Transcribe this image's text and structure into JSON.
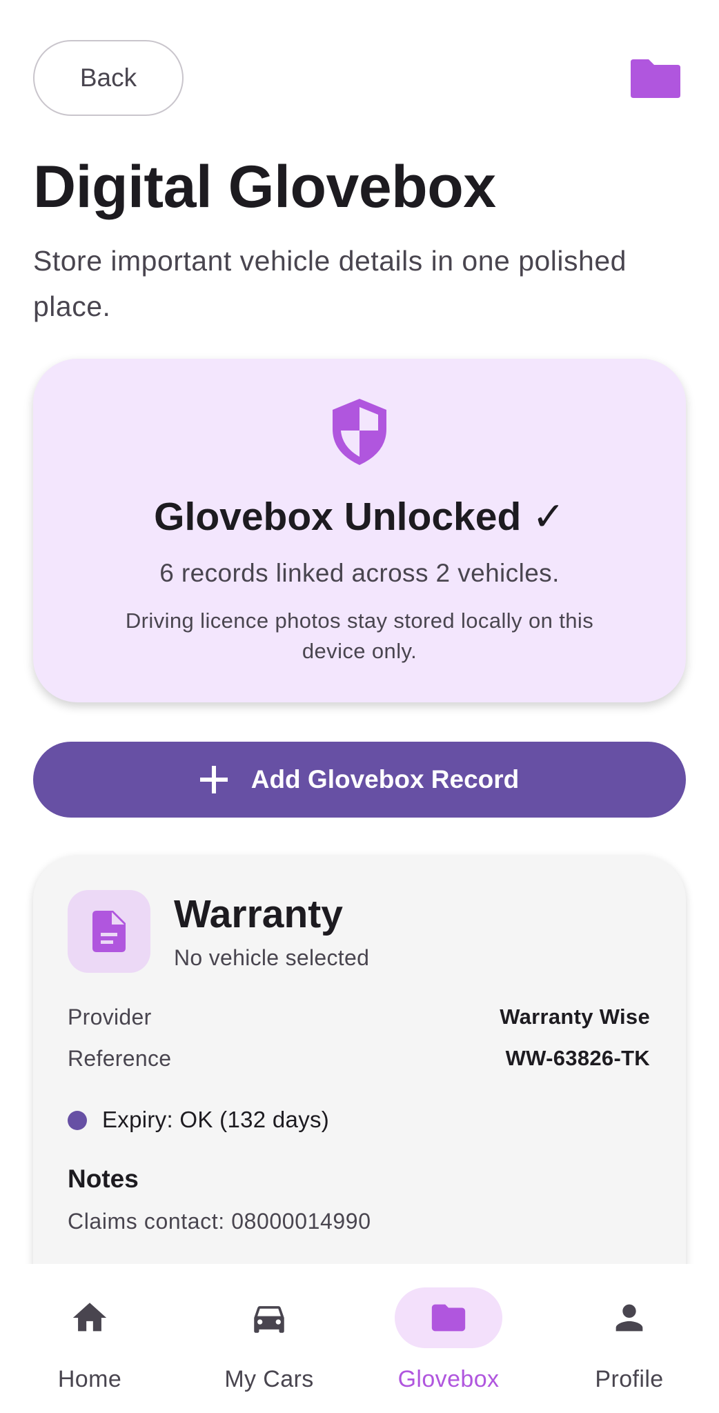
{
  "header": {
    "back_label": "Back",
    "folder_icon": "folder-icon",
    "title": "Digital Glovebox",
    "subtitle": "Store important vehicle details in one polished place."
  },
  "status_card": {
    "icon": "shield-icon",
    "title": "Glovebox Unlocked ✓",
    "summary": "6 records linked across 2 vehicles.",
    "note": "Driving licence photos stay stored locally on this device only."
  },
  "add_button": {
    "icon": "plus-icon",
    "label": "Add Glovebox Record"
  },
  "record": {
    "icon": "document-icon",
    "title": "Warranty",
    "subtitle": "No vehicle selected",
    "fields": [
      {
        "label": "Provider",
        "value": "Warranty Wise"
      },
      {
        "label": "Reference",
        "value": "WW-63826-TK"
      }
    ],
    "expiry": "Expiry: OK (132 days)",
    "notes_heading": "Notes",
    "notes_text": "Claims contact: 08000014990"
  },
  "nav": {
    "items": [
      {
        "label": "Home",
        "icon": "home-icon"
      },
      {
        "label": "My Cars",
        "icon": "car-icon"
      },
      {
        "label": "Glovebox",
        "icon": "folder-icon",
        "active": true
      },
      {
        "label": "Profile",
        "icon": "person-icon"
      }
    ]
  },
  "colors": {
    "accent": "#b056de",
    "primary": "#6750a4",
    "status_card_bg": "#f3e6fd",
    "record_card_bg": "#f5f5f5"
  }
}
